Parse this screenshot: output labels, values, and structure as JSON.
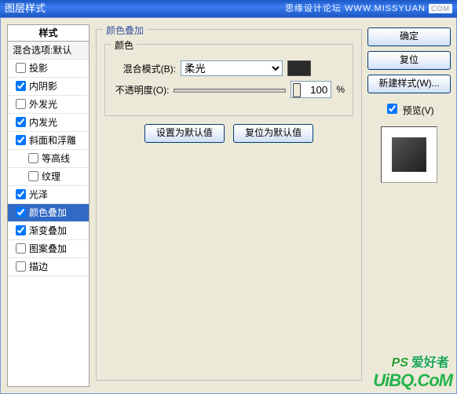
{
  "titlebar": {
    "title": "图层样式",
    "brand": "思缘设计论坛",
    "brand_url_text": "WWW.MISSYUAN",
    "brand_badge": "COM"
  },
  "styles_header": "样式",
  "styles_subhead": "混合选项:默认",
  "style_items": [
    {
      "label": "投影",
      "checked": false,
      "active": false,
      "indent": false
    },
    {
      "label": "内阴影",
      "checked": true,
      "active": false,
      "indent": false
    },
    {
      "label": "外发光",
      "checked": false,
      "active": false,
      "indent": false
    },
    {
      "label": "内发光",
      "checked": true,
      "active": false,
      "indent": false
    },
    {
      "label": "斜面和浮雕",
      "checked": true,
      "active": false,
      "indent": false
    },
    {
      "label": "等高线",
      "checked": false,
      "active": false,
      "indent": true
    },
    {
      "label": "纹理",
      "checked": false,
      "active": false,
      "indent": true
    },
    {
      "label": "光泽",
      "checked": true,
      "active": false,
      "indent": false
    },
    {
      "label": "颜色叠加",
      "checked": true,
      "active": true,
      "indent": false
    },
    {
      "label": "渐变叠加",
      "checked": true,
      "active": false,
      "indent": false
    },
    {
      "label": "图案叠加",
      "checked": false,
      "active": false,
      "indent": false
    },
    {
      "label": "描边",
      "checked": false,
      "active": false,
      "indent": false
    }
  ],
  "center": {
    "group_title": "颜色叠加",
    "inner_title": "颜色",
    "blend_label": "混合模式(B):",
    "blend_value": "柔光",
    "opacity_label": "不透明度(O):",
    "opacity_value": "100",
    "opacity_unit": "%",
    "btn_set_default": "设置为默认值",
    "btn_reset_default": "复位为默认值",
    "swatch_color": "#2a2a2a"
  },
  "right": {
    "ok": "确定",
    "reset": "复位",
    "newstyle": "新建样式(W)...",
    "preview_label": "预览(V)",
    "preview_checked": true
  },
  "watermark": {
    "line1_ps": "PS",
    "line1_rest": "爱好者",
    "line2": "UiBQ.CoM"
  }
}
